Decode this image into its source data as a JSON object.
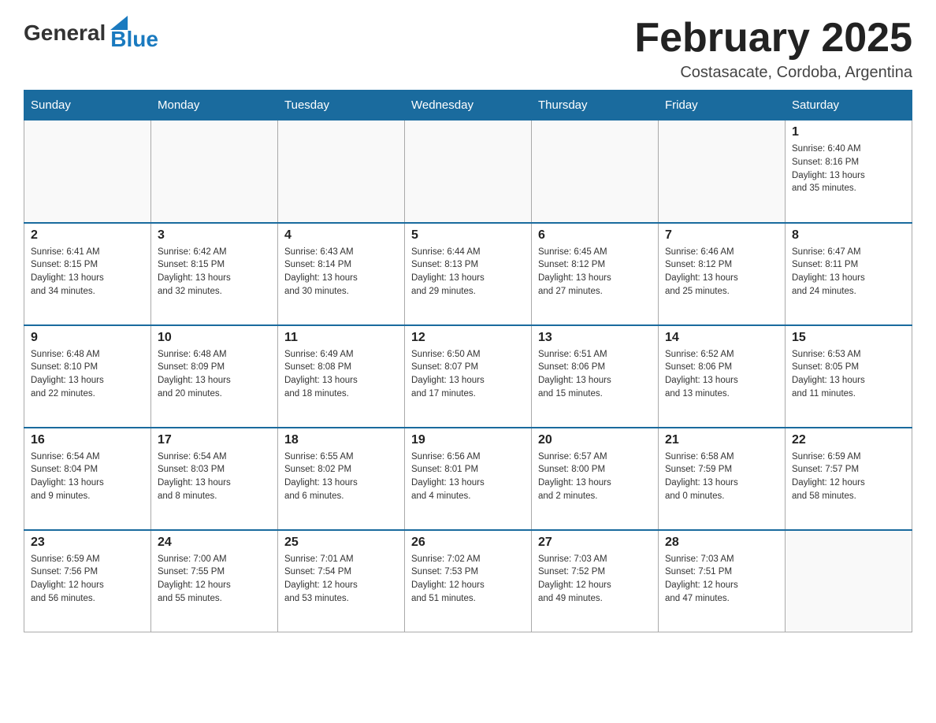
{
  "logo": {
    "text_general": "General",
    "text_blue": "Blue"
  },
  "title": "February 2025",
  "subtitle": "Costasacate, Cordoba, Argentina",
  "days_of_week": [
    "Sunday",
    "Monday",
    "Tuesday",
    "Wednesday",
    "Thursday",
    "Friday",
    "Saturday"
  ],
  "weeks": [
    [
      {
        "day": "",
        "info": ""
      },
      {
        "day": "",
        "info": ""
      },
      {
        "day": "",
        "info": ""
      },
      {
        "day": "",
        "info": ""
      },
      {
        "day": "",
        "info": ""
      },
      {
        "day": "",
        "info": ""
      },
      {
        "day": "1",
        "info": "Sunrise: 6:40 AM\nSunset: 8:16 PM\nDaylight: 13 hours\nand 35 minutes."
      }
    ],
    [
      {
        "day": "2",
        "info": "Sunrise: 6:41 AM\nSunset: 8:15 PM\nDaylight: 13 hours\nand 34 minutes."
      },
      {
        "day": "3",
        "info": "Sunrise: 6:42 AM\nSunset: 8:15 PM\nDaylight: 13 hours\nand 32 minutes."
      },
      {
        "day": "4",
        "info": "Sunrise: 6:43 AM\nSunset: 8:14 PM\nDaylight: 13 hours\nand 30 minutes."
      },
      {
        "day": "5",
        "info": "Sunrise: 6:44 AM\nSunset: 8:13 PM\nDaylight: 13 hours\nand 29 minutes."
      },
      {
        "day": "6",
        "info": "Sunrise: 6:45 AM\nSunset: 8:12 PM\nDaylight: 13 hours\nand 27 minutes."
      },
      {
        "day": "7",
        "info": "Sunrise: 6:46 AM\nSunset: 8:12 PM\nDaylight: 13 hours\nand 25 minutes."
      },
      {
        "day": "8",
        "info": "Sunrise: 6:47 AM\nSunset: 8:11 PM\nDaylight: 13 hours\nand 24 minutes."
      }
    ],
    [
      {
        "day": "9",
        "info": "Sunrise: 6:48 AM\nSunset: 8:10 PM\nDaylight: 13 hours\nand 22 minutes."
      },
      {
        "day": "10",
        "info": "Sunrise: 6:48 AM\nSunset: 8:09 PM\nDaylight: 13 hours\nand 20 minutes."
      },
      {
        "day": "11",
        "info": "Sunrise: 6:49 AM\nSunset: 8:08 PM\nDaylight: 13 hours\nand 18 minutes."
      },
      {
        "day": "12",
        "info": "Sunrise: 6:50 AM\nSunset: 8:07 PM\nDaylight: 13 hours\nand 17 minutes."
      },
      {
        "day": "13",
        "info": "Sunrise: 6:51 AM\nSunset: 8:06 PM\nDaylight: 13 hours\nand 15 minutes."
      },
      {
        "day": "14",
        "info": "Sunrise: 6:52 AM\nSunset: 8:06 PM\nDaylight: 13 hours\nand 13 minutes."
      },
      {
        "day": "15",
        "info": "Sunrise: 6:53 AM\nSunset: 8:05 PM\nDaylight: 13 hours\nand 11 minutes."
      }
    ],
    [
      {
        "day": "16",
        "info": "Sunrise: 6:54 AM\nSunset: 8:04 PM\nDaylight: 13 hours\nand 9 minutes."
      },
      {
        "day": "17",
        "info": "Sunrise: 6:54 AM\nSunset: 8:03 PM\nDaylight: 13 hours\nand 8 minutes."
      },
      {
        "day": "18",
        "info": "Sunrise: 6:55 AM\nSunset: 8:02 PM\nDaylight: 13 hours\nand 6 minutes."
      },
      {
        "day": "19",
        "info": "Sunrise: 6:56 AM\nSunset: 8:01 PM\nDaylight: 13 hours\nand 4 minutes."
      },
      {
        "day": "20",
        "info": "Sunrise: 6:57 AM\nSunset: 8:00 PM\nDaylight: 13 hours\nand 2 minutes."
      },
      {
        "day": "21",
        "info": "Sunrise: 6:58 AM\nSunset: 7:59 PM\nDaylight: 13 hours\nand 0 minutes."
      },
      {
        "day": "22",
        "info": "Sunrise: 6:59 AM\nSunset: 7:57 PM\nDaylight: 12 hours\nand 58 minutes."
      }
    ],
    [
      {
        "day": "23",
        "info": "Sunrise: 6:59 AM\nSunset: 7:56 PM\nDaylight: 12 hours\nand 56 minutes."
      },
      {
        "day": "24",
        "info": "Sunrise: 7:00 AM\nSunset: 7:55 PM\nDaylight: 12 hours\nand 55 minutes."
      },
      {
        "day": "25",
        "info": "Sunrise: 7:01 AM\nSunset: 7:54 PM\nDaylight: 12 hours\nand 53 minutes."
      },
      {
        "day": "26",
        "info": "Sunrise: 7:02 AM\nSunset: 7:53 PM\nDaylight: 12 hours\nand 51 minutes."
      },
      {
        "day": "27",
        "info": "Sunrise: 7:03 AM\nSunset: 7:52 PM\nDaylight: 12 hours\nand 49 minutes."
      },
      {
        "day": "28",
        "info": "Sunrise: 7:03 AM\nSunset: 7:51 PM\nDaylight: 12 hours\nand 47 minutes."
      },
      {
        "day": "",
        "info": ""
      }
    ]
  ]
}
